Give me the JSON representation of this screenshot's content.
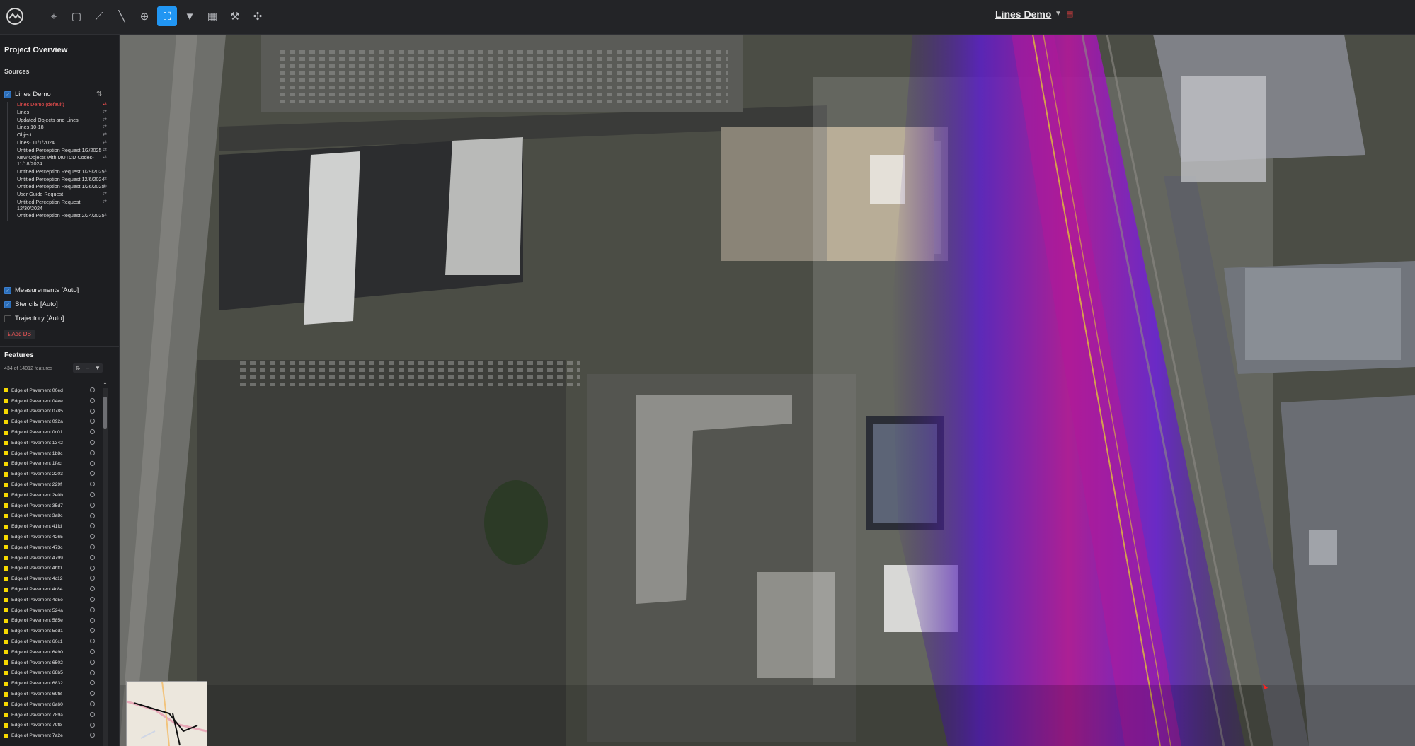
{
  "header": {
    "project_title": "Lines Demo",
    "tools": [
      "pin-icon",
      "square-icon",
      "polyline-icon",
      "ruler-icon",
      "target-icon",
      "fullscreen-icon",
      "flashlight-icon",
      "grid-icon",
      "hammer-icon",
      "drone-icon"
    ],
    "active_tool": "fullscreen-icon"
  },
  "panel": {
    "title": "Project Overview",
    "sources_label": "Sources",
    "sources": {
      "main": "Lines Demo",
      "items": [
        "Lines Demo (default)",
        "Lines",
        "Updated Objects and Lines",
        "Lines 10-18",
        "Object",
        "Lines- 11/1/2024",
        "Untitled Perception Request 1/3/2025",
        "New Objects with MUTCD Codes- 11/18/2024",
        "Untitled Perception Request 1/29/2025",
        "Untitled Perception Request 12/6/2024",
        "Untitled Perception Request 1/26/2025",
        "User Guide Request",
        "Untitled Perception Request 12/30/2024",
        "Untitled Perception Request 2/24/2025"
      ],
      "measurements": "Measurements [Auto]",
      "stencils": "Stencils [Auto]",
      "trajectory": "Trajectory [Auto]",
      "add_button": "Add DB"
    },
    "features_label": "Features",
    "features_count": "434 of 14012 features",
    "features": [
      "Edge of Pavement 00ed",
      "Edge of Pavement 04ee",
      "Edge of Pavement 0785",
      "Edge of Pavement 092a",
      "Edge of Pavement 0c01",
      "Edge of Pavement 1342",
      "Edge of Pavement 1b8c",
      "Edge of Pavement 1fec",
      "Edge of Pavement 2203",
      "Edge of Pavement 229f",
      "Edge of Pavement 2e0b",
      "Edge of Pavement 35d7",
      "Edge of Pavement 3a8c",
      "Edge of Pavement 41fd",
      "Edge of Pavement 4265",
      "Edge of Pavement 473c",
      "Edge of Pavement 4799",
      "Edge of Pavement 4bf0",
      "Edge of Pavement 4c12",
      "Edge of Pavement 4c84",
      "Edge of Pavement 4d5e",
      "Edge of Pavement 524a",
      "Edge of Pavement 585e",
      "Edge of Pavement 5ed1",
      "Edge of Pavement 60c1",
      "Edge of Pavement 6490",
      "Edge of Pavement 6502",
      "Edge of Pavement 68b5",
      "Edge of Pavement 6832",
      "Edge of Pavement 69f8",
      "Edge of Pavement 6a60",
      "Edge of Pavement 789a",
      "Edge of Pavement 79fb",
      "Edge of Pavement 7a2e"
    ]
  },
  "colors": {
    "accent": "#2196f3",
    "feature_swatch": "#f5d800",
    "point_cloud_purple": "#6a1fd6",
    "point_cloud_magenta": "#c21ea0"
  }
}
